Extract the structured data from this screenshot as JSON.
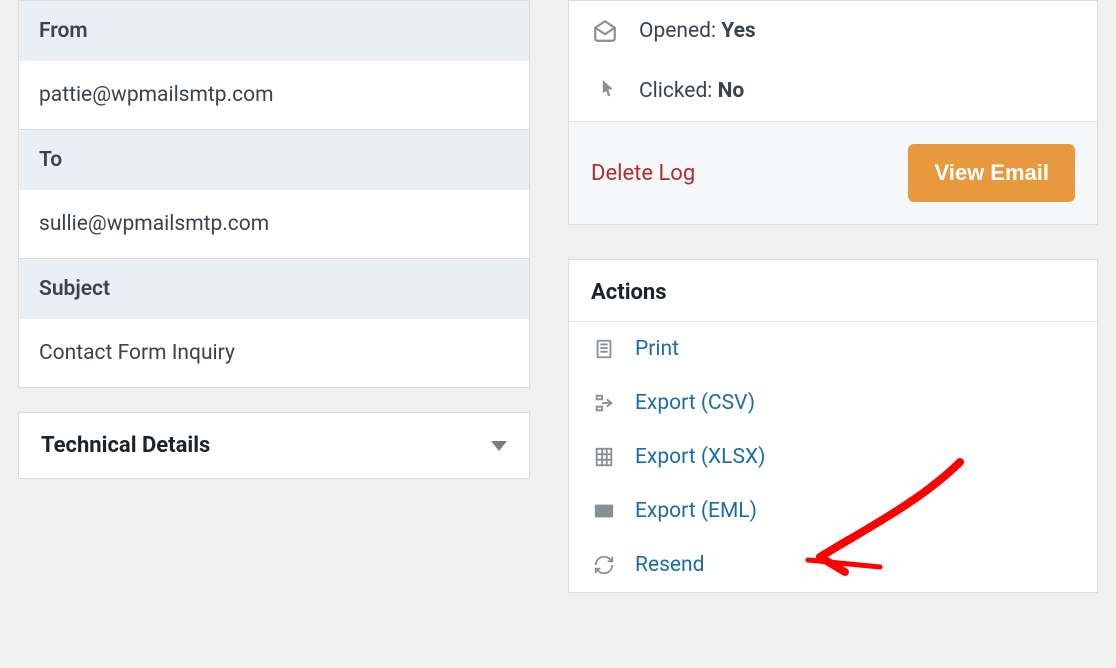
{
  "details": {
    "from_label": "From",
    "from_value": "pattie@wpmailsmtp.com",
    "to_label": "To",
    "to_value": "sullie@wpmailsmtp.com",
    "subject_label": "Subject",
    "subject_value": "Contact Form Inquiry"
  },
  "technical": {
    "title": "Technical Details"
  },
  "status": {
    "opened_label": "Opened: ",
    "opened_value": "Yes",
    "clicked_label": "Clicked: ",
    "clicked_value": "No",
    "delete_label": "Delete Log",
    "view_label": "View Email"
  },
  "actions": {
    "title": "Actions",
    "items": [
      {
        "label": "Print"
      },
      {
        "label": "Export (CSV)"
      },
      {
        "label": "Export (XLSX)"
      },
      {
        "label": "Export (EML)"
      },
      {
        "label": "Resend"
      }
    ]
  }
}
